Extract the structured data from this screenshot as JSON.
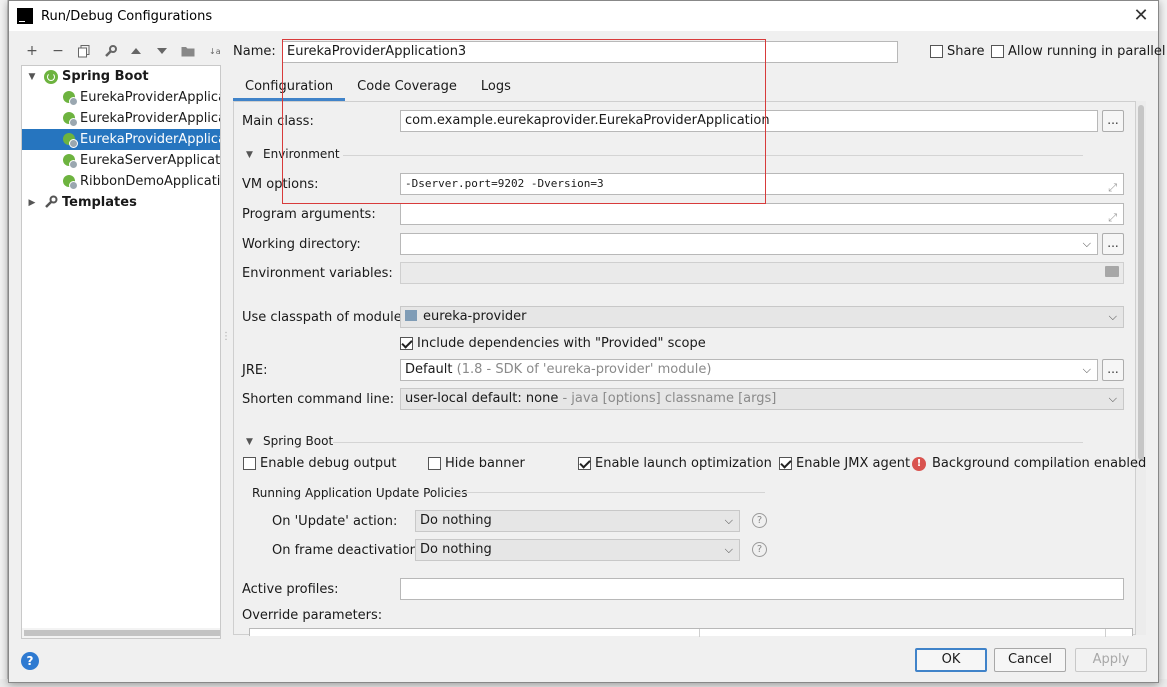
{
  "window": {
    "title": "Run/Debug Configurations"
  },
  "tree": {
    "root": "Spring Boot",
    "items": [
      "EurekaProviderApplicati",
      "EurekaProviderApplicati",
      "EurekaProviderApplicati",
      "EurekaServerApplication",
      "RibbonDemoApplication"
    ],
    "templates": "Templates"
  },
  "header": {
    "name_label": "Name:",
    "name_value": "EurekaProviderApplication3",
    "share_label": "Share",
    "allow_parallel_label": "Allow running in parallel"
  },
  "tabs": [
    "Configuration",
    "Code Coverage",
    "Logs"
  ],
  "config": {
    "main_class_label": "Main class:",
    "main_class_value": "com.example.eurekaprovider.EurekaProviderApplication",
    "environment_section": "Environment",
    "vm_options_label": "VM options:",
    "vm_options_value": "-Dserver.port=9202 -Dversion=3",
    "program_args_label": "Program arguments:",
    "working_dir_label": "Working directory:",
    "env_vars_label": "Environment variables:",
    "classpath_label": "Use classpath of module:",
    "classpath_value": "eureka-provider",
    "include_provided_label": "Include dependencies with \"Provided\" scope",
    "jre_label": "JRE:",
    "jre_value": "Default",
    "jre_hint": "(1.8 - SDK of 'eureka-provider' module)",
    "shorten_label": "Shorten command line:",
    "shorten_value": "user-local default: none",
    "shorten_hint": "- java [options] classname [args]",
    "spring_boot_section": "Spring Boot",
    "enable_debug_label": "Enable debug output",
    "hide_banner_label": "Hide banner",
    "launch_opt_label": "Enable launch optimization",
    "jmx_label": "Enable JMX agent",
    "bg_compile_label": "Background compilation enabled",
    "update_policies_label": "Running Application Update Policies",
    "on_update_label": "On 'Update' action:",
    "on_update_value": "Do nothing",
    "on_frame_label": "On frame deactivation:",
    "on_frame_value": "Do nothing",
    "active_profiles_label": "Active profiles:",
    "override_params_label": "Override parameters:"
  },
  "footer": {
    "ok": "OK",
    "cancel": "Cancel",
    "apply": "Apply",
    "help": "?"
  },
  "colors": {
    "selection": "#2675bf",
    "accent": "#4083c9",
    "highlight_box": "#d83b3b",
    "spring": "#6db33f"
  }
}
